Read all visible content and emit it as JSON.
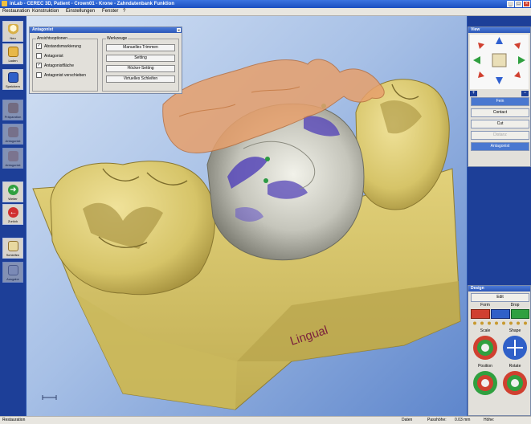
{
  "window": {
    "title": "inLab - CEREC 3D, Patient - Crown01 - Krone - Zahndatenbank Funktion",
    "controls": {
      "minimize": "_",
      "maximize": "□",
      "close": "×"
    }
  },
  "menu": {
    "items": [
      "Restauration",
      "Konstruktion",
      "Einstellungen",
      "Fenster",
      "?"
    ]
  },
  "sidebar": {
    "items": [
      {
        "label": "Neu",
        "icon": "tooth-new-icon",
        "enabled": true
      },
      {
        "label": "Laden",
        "icon": "folder-icon",
        "enabled": true
      },
      {
        "label": "Speichern",
        "icon": "save-disk-icon",
        "enabled": true
      },
      {
        "label": "Präparation",
        "icon": "preparation-icon",
        "enabled": false
      },
      {
        "label": "Antagonist",
        "icon": "antagonist-icon",
        "enabled": false
      },
      {
        "label": "Antagonist",
        "icon": "antagonist-2-icon",
        "enabled": false
      },
      {
        "label": "Weiter",
        "icon": "arrow-right-icon",
        "enabled": true
      },
      {
        "label": "Zurück",
        "icon": "arrow-left-icon",
        "enabled": true
      },
      {
        "label": "Schleifen",
        "icon": "grind-icon",
        "enabled": true
      },
      {
        "label": "Ausgabe",
        "icon": "output-icon",
        "enabled": false
      }
    ]
  },
  "antagonist_panel": {
    "title": "Antagonist",
    "close": "×",
    "view_options": {
      "title": "Ansichtsoptionen",
      "items": [
        {
          "label": "Abstandsmarkierung",
          "checked": true
        },
        {
          "label": "Antagonist",
          "checked": false
        },
        {
          "label": "Antagonistfläche",
          "checked": true
        },
        {
          "label": "Antagonist verschieben",
          "checked": false
        }
      ]
    },
    "tools": {
      "title": "Werkzeuge",
      "buttons": [
        "Manuelles Trimmen",
        "Setting",
        "Höcker-Setting",
        "Virtuelles Schleifen"
      ]
    }
  },
  "view_panel": {
    "title": "View",
    "zoom_in": "+",
    "zoom_out": "−",
    "buttons": [
      {
        "label": "Fein",
        "state": "selected"
      },
      {
        "label": "Contact",
        "state": "normal"
      },
      {
        "label": "Cut",
        "state": "normal"
      },
      {
        "label": "Distanz",
        "state": "disabled"
      },
      {
        "label": "Antagonist",
        "state": "selected"
      }
    ]
  },
  "design_panel": {
    "title": "Design",
    "edit_label": "Edit",
    "form_label": "Form",
    "drop_label": "Drop",
    "scale_label": "Scale",
    "shape_label": "Shape",
    "position_label": "Position",
    "rotate_label": "Rotate"
  },
  "viewport": {
    "side_label": "Lingual",
    "colors": {
      "tooth": "#cfbd62",
      "crown": "#bfbfb4",
      "antagonist": "#e7a06c",
      "contact": "#5646b8"
    }
  },
  "status": {
    "left": "Restauration",
    "fields": [
      "Daten",
      "Passhöhe:",
      "0.03 mm",
      "Höhe:"
    ]
  }
}
